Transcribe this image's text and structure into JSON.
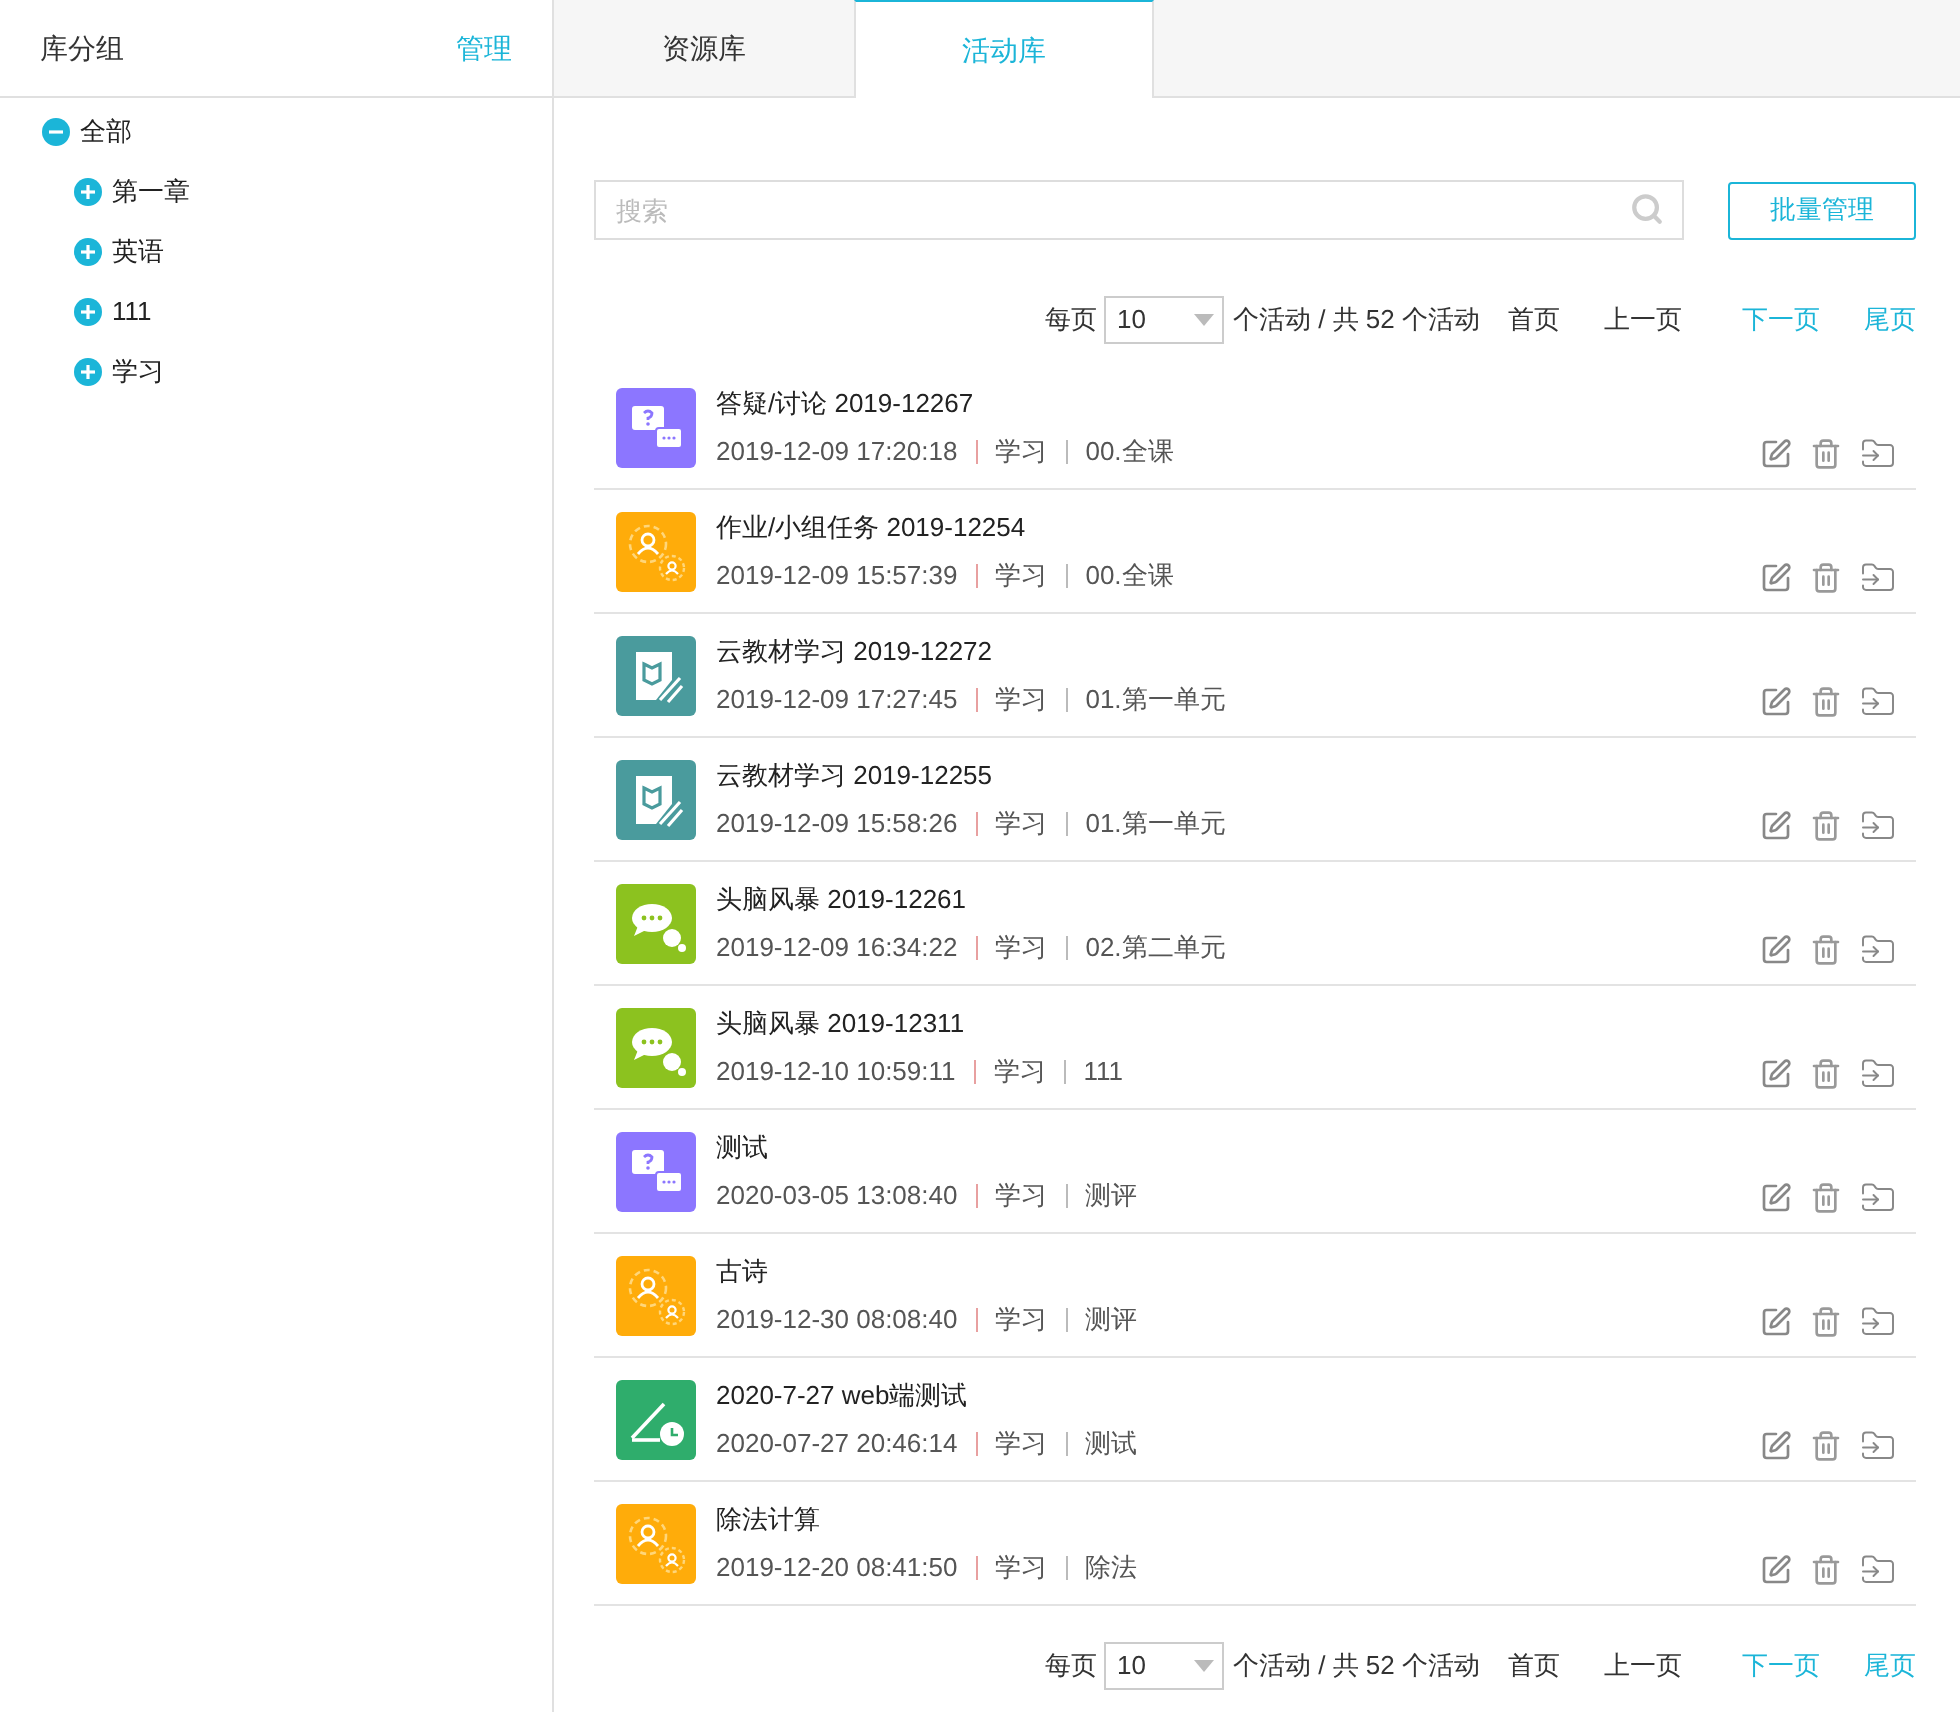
{
  "sidebar": {
    "title": "库分组",
    "action": "管理",
    "tree": [
      {
        "label": "全部",
        "expanded": true,
        "children": [
          {
            "label": "第一章",
            "expanded": false
          },
          {
            "label": "英语",
            "expanded": false
          },
          {
            "label": "111",
            "expanded": false
          },
          {
            "label": "学习",
            "expanded": false
          }
        ]
      }
    ]
  },
  "tabs": [
    {
      "label": "资源库",
      "selected": false
    },
    {
      "label": "活动库",
      "selected": true
    }
  ],
  "search": {
    "placeholder": "搜索"
  },
  "batch_button": "批量管理",
  "pager_top": {
    "per_page_label": "每页",
    "per_page": "10",
    "summary": "个活动 / 共 52 个活动",
    "links": [
      {
        "label": "首页",
        "disabled": true
      },
      {
        "label": "上一页",
        "disabled": true
      },
      {
        "label": "下一页",
        "disabled": false
      },
      {
        "label": "尾页",
        "disabled": false
      }
    ]
  },
  "activities": [
    {
      "kind": "qa",
      "title": "答疑/讨论 2019-12267",
      "time": "2019-12-09 17:20:18",
      "group": "学习",
      "unit": "00.全课"
    },
    {
      "kind": "task",
      "title": "作业/小组任务 2019-12254",
      "time": "2019-12-09 15:57:39",
      "group": "学习",
      "unit": "00.全课"
    },
    {
      "kind": "textbook",
      "title": "云教材学习 2019-12272",
      "time": "2019-12-09 17:27:45",
      "group": "学习",
      "unit": "01.第一单元"
    },
    {
      "kind": "textbook",
      "title": "云教材学习 2019-12255",
      "time": "2019-12-09 15:58:26",
      "group": "学习",
      "unit": "01.第一单元"
    },
    {
      "kind": "brainstorm",
      "title": "头脑风暴 2019-12261",
      "time": "2019-12-09 16:34:22",
      "group": "学习",
      "unit": "02.第二单元"
    },
    {
      "kind": "brainstorm",
      "title": "头脑风暴 2019-12311",
      "time": "2019-12-10 10:59:11",
      "group": "学习",
      "unit": "111"
    },
    {
      "kind": "qa",
      "title": "测试",
      "time": "2020-03-05 13:08:40",
      "group": "学习",
      "unit": "测评"
    },
    {
      "kind": "task",
      "title": "古诗",
      "time": "2019-12-30 08:08:40",
      "group": "学习",
      "unit": "测评"
    },
    {
      "kind": "test",
      "title": "2020-7-27 web端测试",
      "time": "2020-07-27 20:46:14",
      "group": "学习",
      "unit": "测试"
    },
    {
      "kind": "task",
      "title": "除法计算",
      "time": "2019-12-20 08:41:50",
      "group": "学习",
      "unit": "除法"
    }
  ],
  "pager_bottom": {
    "per_page_label": "每页",
    "per_page": "10",
    "summary": "个活动 / 共 52 个活动",
    "links": [
      {
        "label": "首页",
        "disabled": true
      },
      {
        "label": "上一页",
        "disabled": true
      },
      {
        "label": "下一页",
        "disabled": false
      },
      {
        "label": "尾页",
        "disabled": false
      }
    ]
  }
}
